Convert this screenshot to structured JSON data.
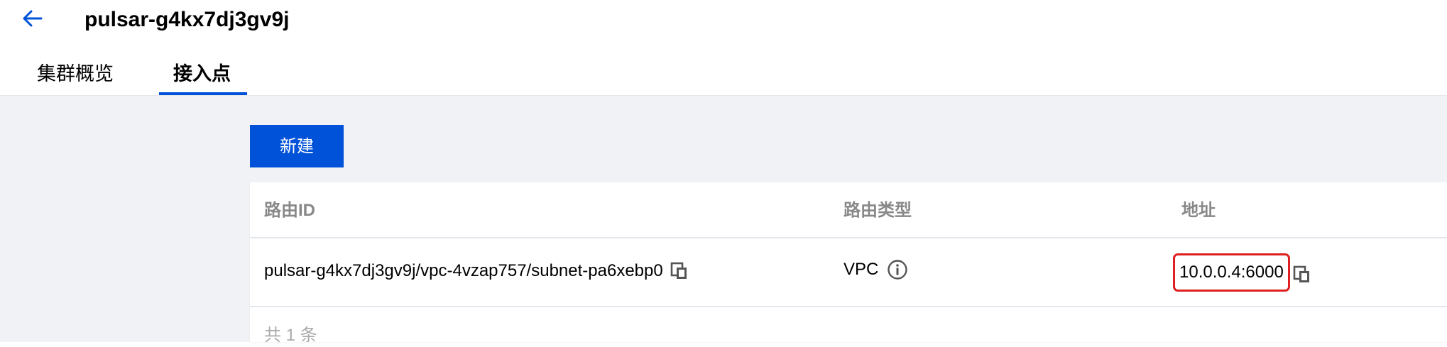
{
  "header": {
    "title": "pulsar-g4kx7dj3gv9j"
  },
  "tabs": [
    {
      "label": "集群概览",
      "active": false
    },
    {
      "label": "接入点",
      "active": true
    }
  ],
  "toolbar": {
    "new_label": "新建"
  },
  "table": {
    "columns": [
      "路由ID",
      "路由类型",
      "地址"
    ],
    "rows": [
      {
        "route_id": "pulsar-g4kx7dj3gv9j/vpc-4vzap757/subnet-pa6xebp0",
        "route_type": "VPC",
        "address": "10.0.0.4:6000"
      }
    ],
    "footer": "共 1 条"
  },
  "colors": {
    "accent": "#0052d9",
    "highlight": "#e02020",
    "background": "#f0f2f5"
  },
  "icons": {
    "back": "arrow-left-icon",
    "copy": "copy-icon",
    "info": "info-circle-icon"
  }
}
